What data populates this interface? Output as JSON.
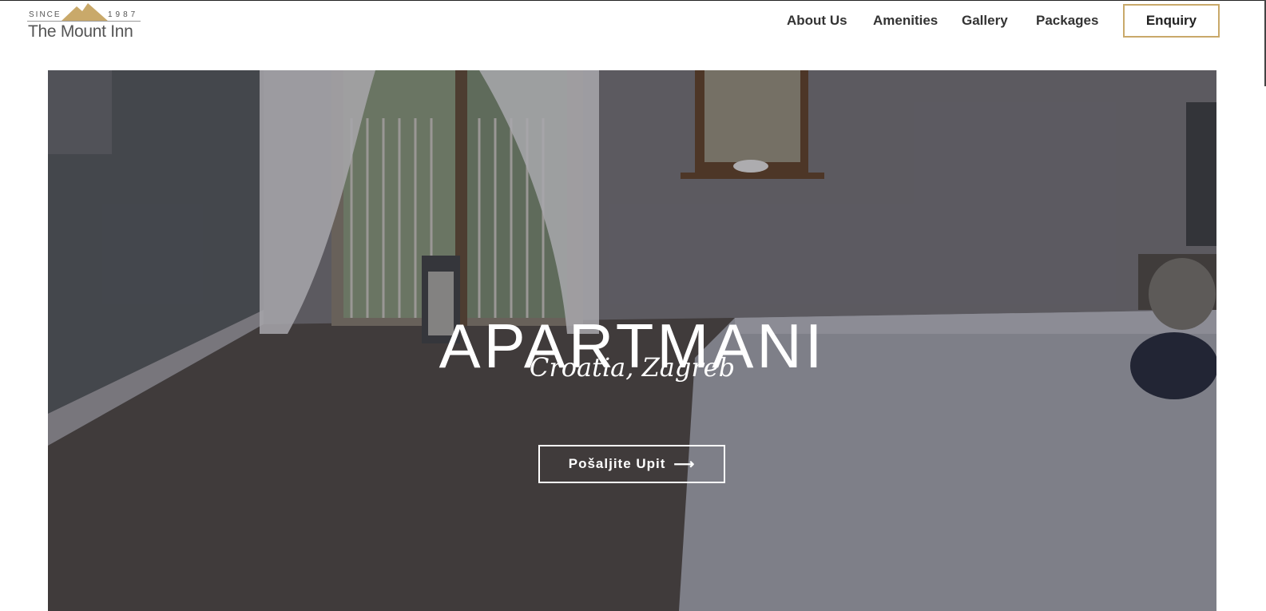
{
  "brand": {
    "since": "SINCE",
    "year": "1987",
    "name": "The Mount Inn",
    "accent_color": "#c9a96a"
  },
  "nav": {
    "items": [
      {
        "label": "About Us"
      },
      {
        "label": "Amenities"
      },
      {
        "label": "Gallery"
      },
      {
        "label": "Packages"
      }
    ],
    "enquiry_label": "Enquiry"
  },
  "hero": {
    "title": "APARTMANI",
    "subtitle": "Croatia, Zagreb",
    "cta_label": "Pošaljite Upit",
    "cta_icon": "arrow-right-icon",
    "background": "bedroom-photo"
  }
}
